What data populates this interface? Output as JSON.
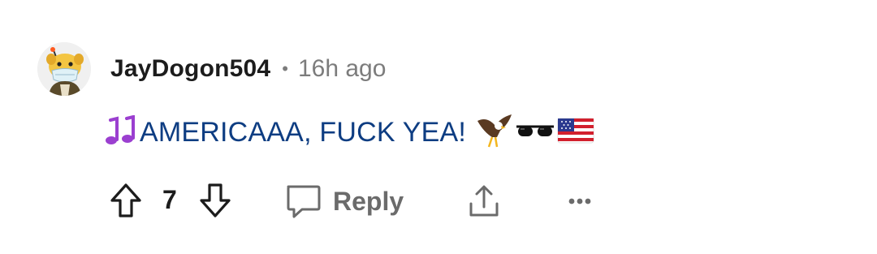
{
  "comment": {
    "author": "JayDogon504",
    "separator": "•",
    "timestamp": "16h ago",
    "text": "AMERICAAA, FUCK YEA!",
    "leading_emoji": "musical-notes-icon",
    "trailing_emojis": [
      "eagle-icon",
      "sunglasses-icon",
      "us-flag-icon"
    ],
    "colors": {
      "text": "#0e3d82",
      "author": "#1c1c1c",
      "meta": "#7c7c7c",
      "action": "#6b6b6b"
    }
  },
  "actions": {
    "upvote_icon": "upvote-arrow-icon",
    "vote_count": "7",
    "downvote_icon": "downvote-arrow-icon",
    "reply_icon": "speech-bubble-icon",
    "reply_label": "Reply",
    "share_icon": "share-icon",
    "more_icon": "more-options-icon"
  }
}
